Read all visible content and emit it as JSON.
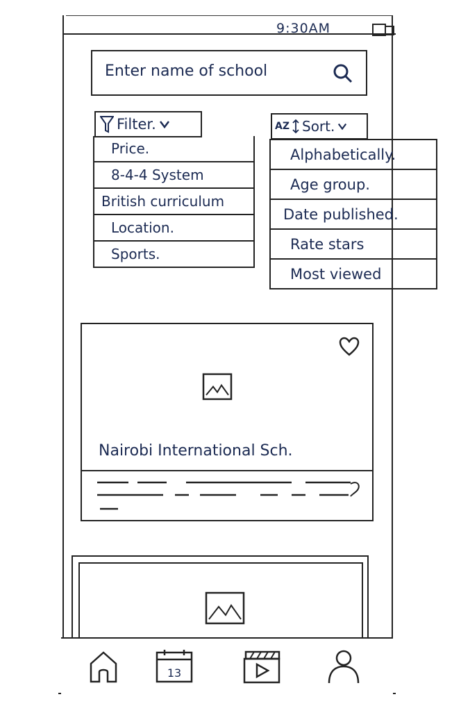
{
  "status_bar": {
    "time": "9:30AM"
  },
  "search": {
    "placeholder": "Enter name of school"
  },
  "filter": {
    "label": "Filter.",
    "items": [
      "Price.",
      "8-4-4 System",
      "British curriculum",
      "Location.",
      "Sports."
    ]
  },
  "sort": {
    "label": "Sort.",
    "icon_text": "AZ",
    "items": [
      "Alphabetically.",
      "Age group.",
      "Date published.",
      "Rate stars",
      "Most viewed"
    ]
  },
  "cards": [
    {
      "title": "Nairobi International Sch."
    }
  ],
  "nav": {
    "calendar_day": "13"
  },
  "colors": {
    "ink": "#1b2a52",
    "line": "#222222"
  }
}
